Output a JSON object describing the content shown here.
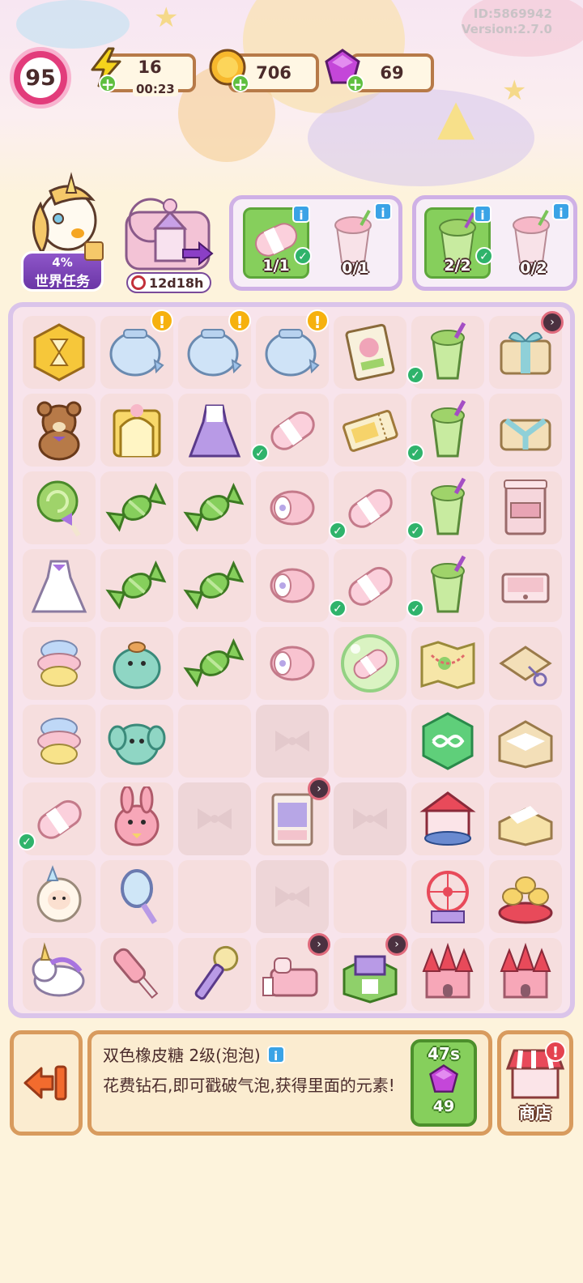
{
  "header": {
    "id_text": "ID:5869942",
    "version_text": "Version:2.7.0",
    "level": "95",
    "energy": {
      "value": "16",
      "timer": "00:23"
    },
    "coins": {
      "value": "706"
    },
    "gems": {
      "value": "69"
    }
  },
  "world_task": {
    "progress": "4%",
    "label": "世界任务",
    "progress_fraction": 0.04
  },
  "event": {
    "timer": "12d18h"
  },
  "orders": [
    {
      "slots": [
        {
          "icon": "marshmallow-roll-icon",
          "count": "1/1",
          "done": true
        },
        {
          "icon": "strawberry-smoothie-icon",
          "count": "0/1",
          "done": false
        }
      ]
    },
    {
      "slots": [
        {
          "icon": "melon-smoothie-icon",
          "count": "2/2",
          "done": true
        },
        {
          "icon": "strawberry-smoothie-icon",
          "count": "0/2",
          "done": false
        }
      ]
    }
  ],
  "board": {
    "rows": [
      [
        "hourglass-generator",
        "fishbowl",
        "fishbowl",
        "fishbowl",
        "storybook",
        "melon-smoothie",
        "gift-box"
      ],
      [
        "teddy-bear",
        "golden-gate",
        "purple-dress",
        "marshmallow-roll",
        "ticket",
        "melon-smoothie",
        "ribbon-box"
      ],
      [
        "lollipop",
        "green-candy",
        "green-candy",
        "swiss-roll",
        "marshmallow-roll",
        "melon-smoothie",
        "dresser-cabinet"
      ],
      [
        "white-dress",
        "green-candy",
        "green-candy",
        "swiss-roll",
        "marshmallow-roll",
        "melon-smoothie",
        "open-drawer"
      ],
      [
        "cotton-candy",
        "seal-plush",
        "green-candy",
        "swiss-roll",
        "marshmallow-bubble",
        "treasure-map",
        "paper-scissors"
      ],
      [
        "cotton-candy",
        "elephant-plush",
        "empty",
        "locked",
        "empty",
        "infinity-gem",
        "cardboard-box"
      ],
      [
        "marshmallow-roll",
        "bunny-plush",
        "locked",
        "wardrobe",
        "locked",
        "carousel",
        "open-box"
      ],
      [
        "sheep-plush",
        "hand-mirror",
        "empty",
        "locked",
        "empty",
        "ferris-wheel",
        "teacup-ride"
      ],
      [
        "unicorn-plush",
        "curling-roller",
        "makeup-brush",
        "pink-bed",
        "toy-shop",
        "pink-castle",
        "pink-castle"
      ]
    ],
    "checks": [
      "1-3",
      "0-5",
      "1-5",
      "2-4",
      "2-5",
      "3-4",
      "3-5",
      "6-0"
    ],
    "alerts": [
      "0-1",
      "0-2",
      "0-3"
    ],
    "timers": [
      "0-6",
      "6-3",
      "8-3",
      "8-4"
    ]
  },
  "selected_item": {
    "title": "双色橡皮糖 2级(泡泡)",
    "description": "花费钻石,即可戳破气泡,获得里面的元素!",
    "pop_timer": "47s",
    "pop_cost": "49"
  },
  "shop": {
    "label": "商店",
    "alert": "!"
  },
  "colors": {
    "accent_purple": "#cfb1e6",
    "board_bg": "#f8e4ec",
    "panel_border": "#d89b5e",
    "green": "#86cf5c"
  }
}
